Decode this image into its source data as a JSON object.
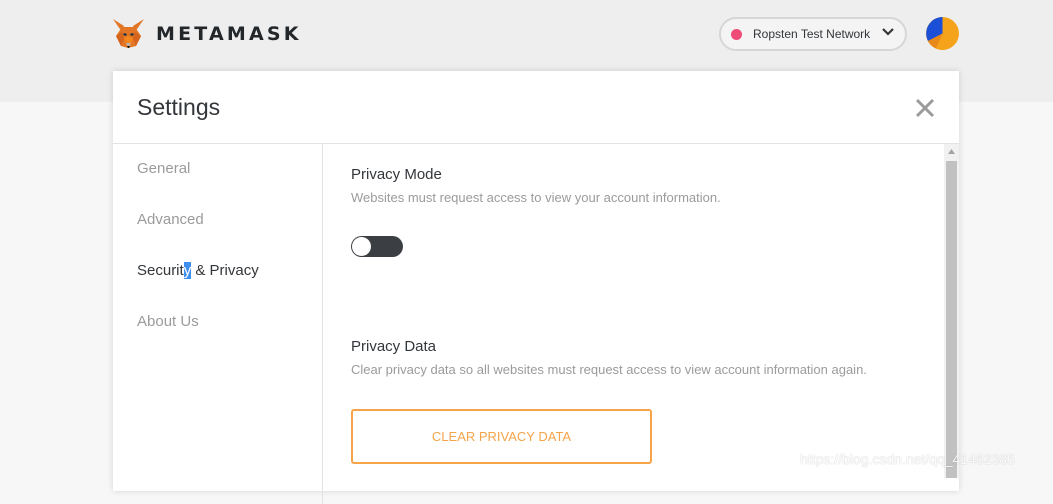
{
  "header": {
    "brand": "METAMASK",
    "network": {
      "label": "Ropsten Test Network",
      "status_color": "#ee4b78"
    }
  },
  "settings": {
    "title": "Settings",
    "sidebar": {
      "items": [
        {
          "label": "General"
        },
        {
          "label": "Advanced"
        },
        {
          "label_before": "Securit",
          "label_selected": "y",
          "label_after": " & Privacy",
          "active": true
        },
        {
          "label": "About Us"
        }
      ]
    },
    "privacy_mode": {
      "title": "Privacy Mode",
      "description": "Websites must request access to view your account information.",
      "enabled": false
    },
    "privacy_data": {
      "title": "Privacy Data",
      "description": "Clear privacy data so all websites must request access to view account information again.",
      "button_label": "CLEAR PRIVACY DATA"
    }
  },
  "watermark": "https://blog.csdn.net/qq_41462385",
  "colors": {
    "accent": "#f5a44a",
    "toggle_track": "#3b3f44",
    "text_selection": "#3e8ff0"
  },
  "icons": [
    "fox-logo-icon",
    "chevron-down-icon",
    "account-avatar-icon",
    "close-icon",
    "scroll-up-arrow-icon"
  ]
}
